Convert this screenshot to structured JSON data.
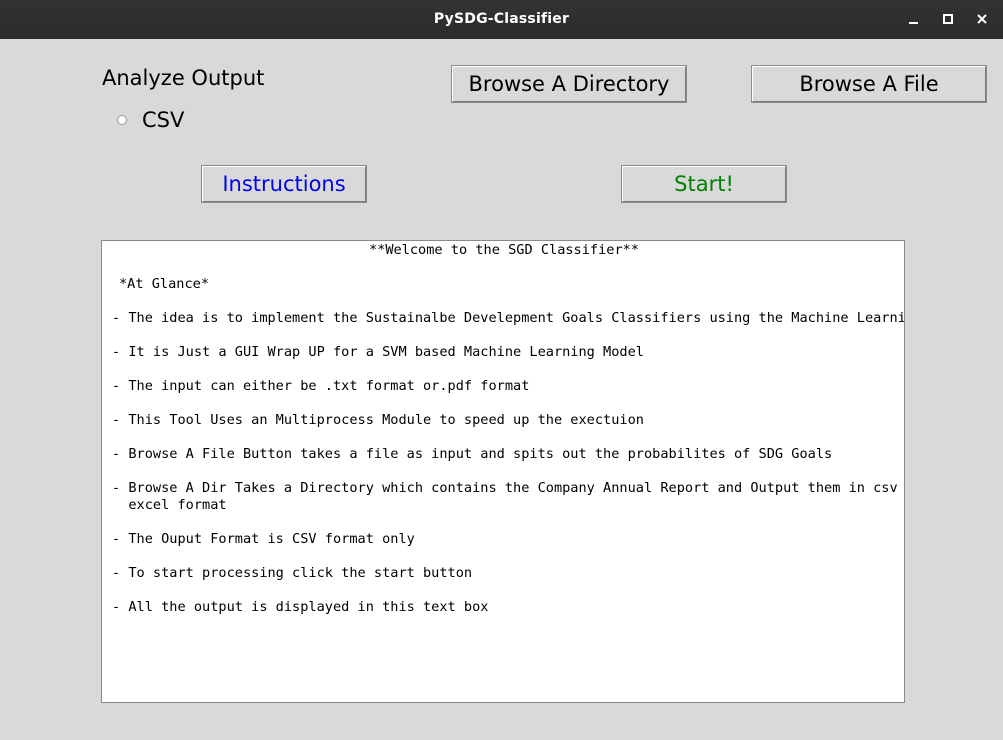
{
  "window": {
    "title": "PySDG-Classifier"
  },
  "controls": {
    "analyze_label": "Analyze Output",
    "csv_radio_label": "CSV",
    "browse_dir_label": "Browse A Directory",
    "browse_file_label": "Browse A File",
    "instructions_label": "Instructions",
    "start_label": "Start!"
  },
  "colors": {
    "instructions_text": "#0000ee",
    "start_text": "#008000"
  },
  "textbox": {
    "heading": "**Welcome to the SGD Classifier**",
    "subheading": "*At Glance*",
    "lines": [
      "- The idea is to implement the Sustainalbe Develepment Goals Classifiers using the Machine Learning",
      "- It is Just a GUI Wrap UP for a SVM based Machine Learning Model",
      "- The input can either be .txt format or.pdf format",
      "- This Tool Uses an Multiprocess Module to speed up the exectuion",
      "- Browse A File Button takes a file as input and spits out the probabilites of SDG Goals",
      "- Browse A Dir Takes a Directory which contains the Company Annual Report and Output them in csv or",
      "  excel format",
      "- The Ouput Format is CSV format only",
      "- To start processing click the start button",
      "- All the output is displayed in this text box"
    ]
  }
}
